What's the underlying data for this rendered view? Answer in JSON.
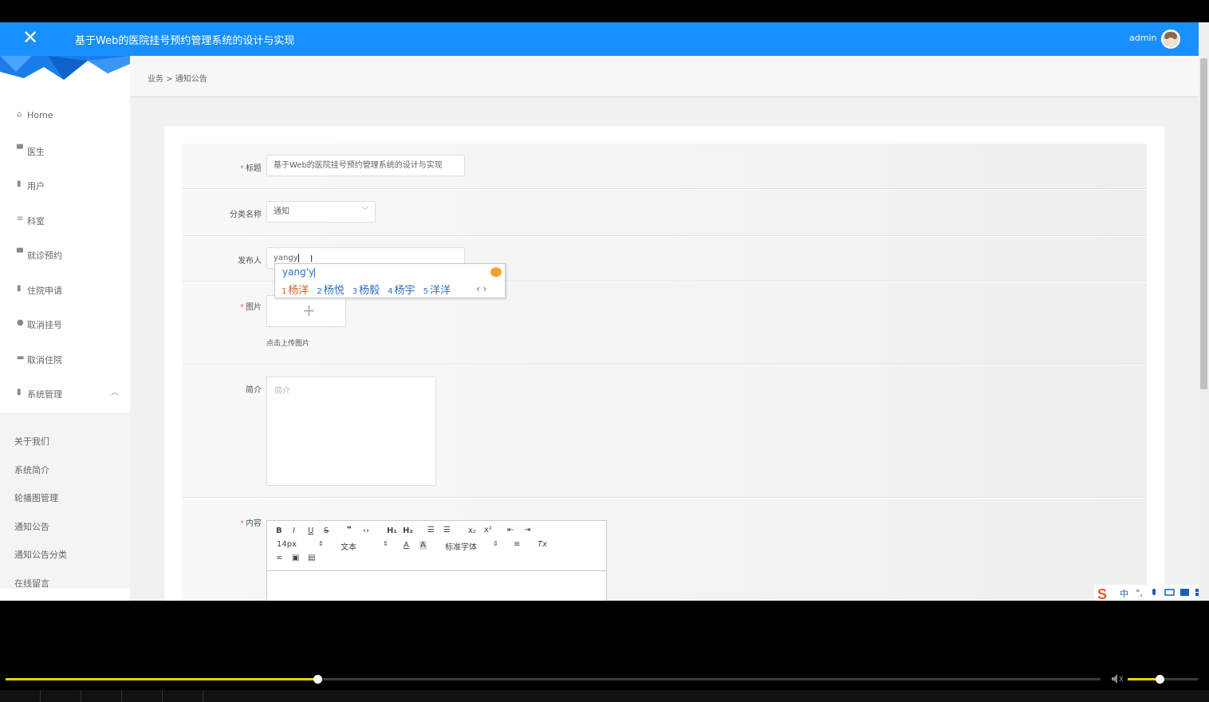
{
  "header": {
    "close_glyph": "✕",
    "title": "基于Web的医院挂号预约管理系统的设计与实现",
    "user": "admin"
  },
  "breadcrumb": {
    "text": "业务 > 通知公告"
  },
  "sidebar": {
    "items": [
      {
        "label": "Home",
        "icon": "home-icon"
      },
      {
        "label": "医生",
        "icon": "message-icon"
      },
      {
        "label": "用户",
        "icon": "document-icon"
      },
      {
        "label": "科室",
        "icon": "sliders-icon"
      },
      {
        "label": "就诊预约",
        "icon": "comment-icon"
      },
      {
        "label": "住院申请",
        "icon": "bar-chart-icon"
      },
      {
        "label": "取消挂号",
        "icon": "location-icon"
      },
      {
        "label": "取消住院",
        "icon": "printer-icon"
      },
      {
        "label": "系统管理",
        "icon": "clipboard-icon"
      }
    ],
    "submenu": [
      "关于我们",
      "系统简介",
      "轮播图管理",
      "通知公告",
      "通知公告分类",
      "在线留言"
    ]
  },
  "form": {
    "title": {
      "label": "标题",
      "value": "基于Web的医院挂号预约管理系统的设计与实现"
    },
    "category": {
      "label": "分类名称",
      "value": "通知"
    },
    "publisher": {
      "label": "发布人",
      "value": "yangy"
    },
    "image": {
      "label": "图片",
      "hint": "点击上传图片"
    },
    "intro": {
      "label": "简介",
      "placeholder": "简介"
    },
    "content": {
      "label": "内容"
    },
    "required_mark": "*"
  },
  "ime": {
    "pinyin": "yang'y",
    "candidates": [
      {
        "n": "1",
        "text": "杨洋"
      },
      {
        "n": "2",
        "text": "杨悦"
      },
      {
        "n": "3",
        "text": "杨毅"
      },
      {
        "n": "4",
        "text": "杨宇"
      },
      {
        "n": "5",
        "text": "洋洋"
      }
    ],
    "nav": "‹ ›"
  },
  "editor": {
    "font_size": "14px",
    "block": "文本",
    "font": "标准字体"
  },
  "player": {
    "progress": 0.285,
    "volume": 0.45
  },
  "colors": {
    "header": "#1890ff",
    "required": "#f56c6c",
    "ime_text": "#2b6fc1",
    "ime_first": "#e0562c",
    "progress": "#f0d000"
  }
}
